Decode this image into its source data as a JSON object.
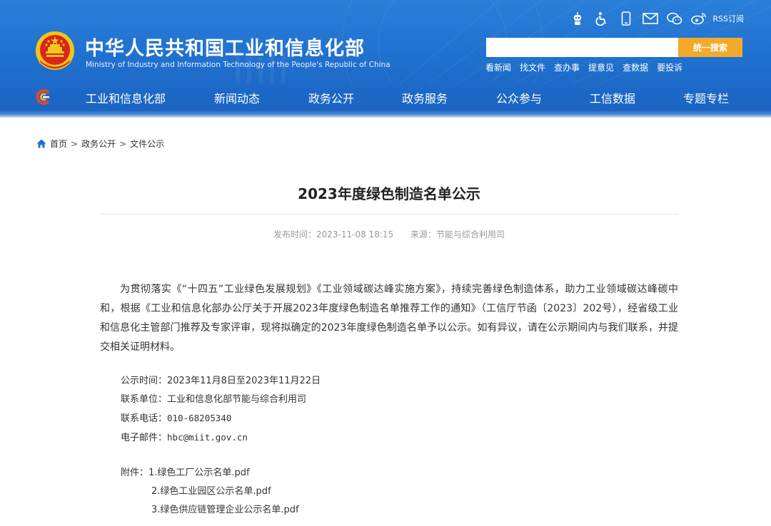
{
  "header": {
    "title_cn": "中华人民共和国工业和信息化部",
    "title_en": "Ministry of Industry and Information Technology of the People's Republic of China",
    "top_icons": [
      "robot-icon",
      "accessibility-icon",
      "mobile-icon",
      "mail-icon",
      "wechat-icon",
      "weibo-icon"
    ],
    "rss_label": "RSS订阅",
    "search": {
      "placeholder": "",
      "button_label": "统一搜索"
    },
    "quick_links": [
      "看新闻",
      "找文件",
      "查办事",
      "提意见",
      "查数据",
      "要投诉"
    ]
  },
  "nav": {
    "items": [
      "工业和信息化部",
      "新闻动态",
      "政务公开",
      "政务服务",
      "公众参与",
      "工信数据",
      "专题专栏"
    ]
  },
  "breadcrumb": [
    "首页",
    "政务公开",
    "文件公示"
  ],
  "breadcrumb_sep": ">",
  "article": {
    "title": "2023年度绿色制造名单公示",
    "publish_label": "发布时间：",
    "publish_time": "2023-11-08 18:15",
    "source_label": "来源：",
    "source": "节能与综合利用司",
    "body": "为贯彻落实《“十四五”工业绿色发展规划》《工业领域碳达峰实施方案》，持续完善绿色制造体系，助力工业领域碳达峰碳中和，根据《工业和信息化部办公厅关于开展2023年度绿色制造名单推荐工作的通知》（工信厅节函〔2023〕202号），经省级工业和信息化主管部门推荐及专家评审，现将拟确定的2023年度绿色制造名单予以公示。如有异议，请在公示期间内与我们联系，并提交相关证明材料。",
    "info": {
      "period_label": "公示时间：",
      "period": "2023年11月8日至2023年11月22日",
      "unit_label": "联系单位：",
      "unit": "工业和信息化部节能与综合利用司",
      "phone_label": "联系电话：",
      "phone": "010-68205340",
      "email_label": "电子邮件：",
      "email": "hbc@miit.gov.cn"
    },
    "attachments_label": "附件：",
    "attachments": [
      "1.绿色工厂公示名单.pdf",
      "2.绿色工业园区公示名单.pdf",
      "3.绿色供应链管理企业公示名单.pdf"
    ]
  },
  "colors": {
    "header_blue": "#1f6fcd",
    "search_button": "#f3a92a",
    "emblem_red": "#d8261b",
    "emblem_gold": "#f5c518"
  }
}
